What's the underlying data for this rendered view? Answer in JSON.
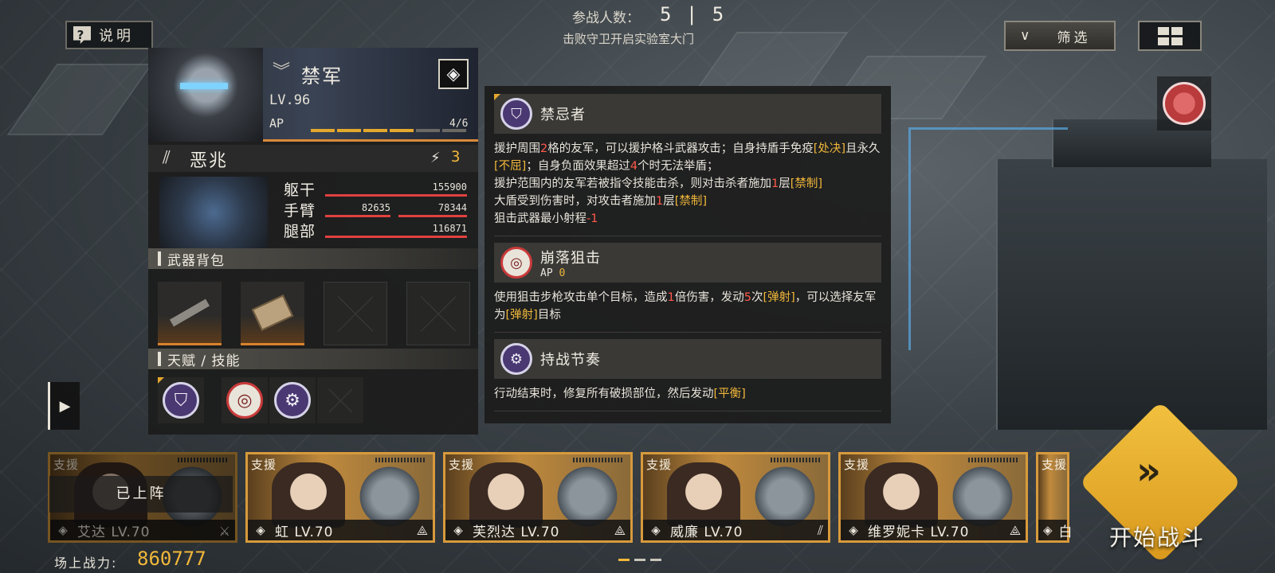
{
  "hud": {
    "help_label": "说明",
    "help_glyph": "?",
    "participants_label": "参战人数：",
    "participants_value": "5 | 5",
    "objective": "击败守卫开启实验室大门",
    "filter_label": "筛选",
    "filter_glyph": "∨"
  },
  "character": {
    "name": "禁军",
    "level": "LV.96",
    "ap_label": "AP",
    "ap_count": "4/6",
    "ap_filled": 4,
    "ap_total": 6,
    "mech_name": "恶兆",
    "mech_ap": "3",
    "parts": [
      {
        "label": "躯干",
        "value": "155900"
      },
      {
        "label": "手臂",
        "value_left": "82635",
        "value_right": "78344"
      },
      {
        "label": "腿部",
        "value": "116871"
      }
    ],
    "weapon_section": "武器背包",
    "talent_section": "天赋 / 技能"
  },
  "skills": [
    {
      "name": "禁忌者",
      "icon": "shield-icon",
      "segments": [
        [
          "援护周围",
          ""
        ],
        [
          "2",
          "r"
        ],
        [
          "格的友军，可以援护格斗武器攻击；自身持盾手免疫",
          ""
        ],
        [
          "[处决]",
          "y"
        ],
        [
          "且永久",
          ""
        ],
        [
          "[不屈]",
          "y"
        ],
        [
          "；自身负面效果超过",
          ""
        ],
        [
          "4",
          "r"
        ],
        [
          "个时无法举盾；",
          ""
        ],
        [
          "\n援护范围内的友军若被指令技能击杀，则对击杀者施加",
          ""
        ],
        [
          "1",
          "r"
        ],
        [
          "层",
          ""
        ],
        [
          "[禁制]",
          "y"
        ],
        [
          "\n大盾受到伤害时，对攻击者施加",
          ""
        ],
        [
          "1",
          "r"
        ],
        [
          "层",
          ""
        ],
        [
          "[禁制]",
          "y"
        ],
        [
          "\n狙击武器最小射程",
          ""
        ],
        [
          "-1",
          "r"
        ]
      ]
    },
    {
      "name": "崩落狙击",
      "icon": "target-icon",
      "ap_label": "AP",
      "ap_value": "0",
      "segments": [
        [
          "使用狙击步枪攻击单个目标，造成",
          ""
        ],
        [
          "1",
          "r"
        ],
        [
          "倍伤害，发动",
          ""
        ],
        [
          "5",
          "r"
        ],
        [
          "次",
          ""
        ],
        [
          "[弹射]",
          "y"
        ],
        [
          "，可以选择友军为",
          ""
        ],
        [
          "[弹射]",
          "y"
        ],
        [
          "目标",
          ""
        ]
      ]
    },
    {
      "name": "持战节奏",
      "icon": "gear-icon",
      "segments": [
        [
          "行动结束时，修复所有破损部位，然后发动",
          ""
        ],
        [
          "[平衡]",
          "y"
        ]
      ]
    }
  ],
  "roster": {
    "support_label": "支援",
    "deployed_label": "已上阵",
    "cards": [
      {
        "name": "艾达 LV.70",
        "deployed": true
      },
      {
        "name": "虹 LV.70",
        "deployed": false
      },
      {
        "name": "芙烈达 LV.70",
        "deployed": false
      },
      {
        "name": "威廉 LV.70",
        "deployed": false
      },
      {
        "name": "维罗妮卡 LV.70",
        "deployed": false
      },
      {
        "name": "白",
        "deployed": false
      }
    ]
  },
  "footer": {
    "power_label": "场上战力:",
    "power_value": "860777",
    "page_count": 3,
    "page_active": 0
  },
  "start": {
    "label": "开始战斗",
    "glyph": "»"
  }
}
